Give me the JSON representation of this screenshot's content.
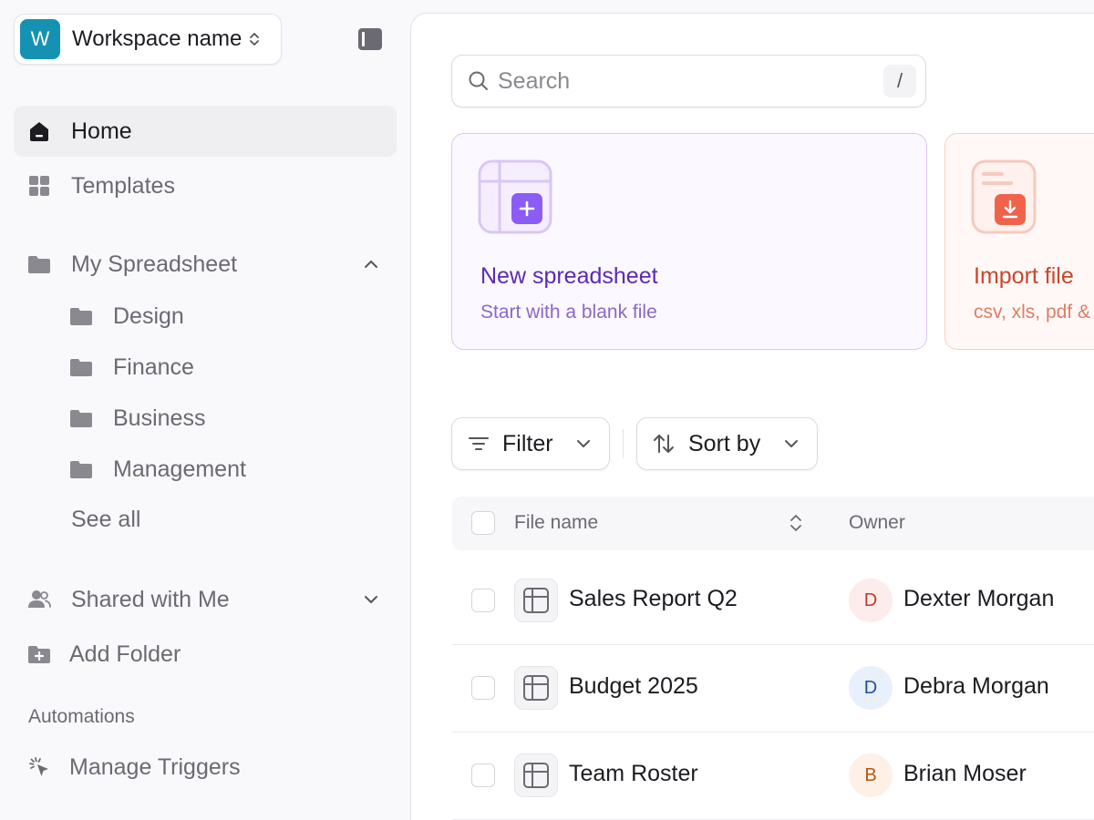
{
  "workspace": {
    "initial": "W",
    "name": "Workspace name",
    "avatar_color": "#1592b3"
  },
  "nav": {
    "home": "Home",
    "templates": "Templates",
    "my_spreadsheet": "My Spreadsheet",
    "folders": [
      "Design",
      "Finance",
      "Business",
      "Management"
    ],
    "see_all": "See all",
    "shared_with_me": "Shared with Me",
    "add_folder": "Add Folder",
    "automations_section": "Automations",
    "manage_triggers": "Manage Triggers"
  },
  "search": {
    "placeholder": "Search",
    "shortcut": "/"
  },
  "cards": {
    "new": {
      "title": "New spreadsheet",
      "subtitle": "Start with a blank file",
      "accent": "#8b5cf6"
    },
    "import": {
      "title": "Import file",
      "subtitle": "csv, xls, pdf &",
      "accent": "#f0634a"
    }
  },
  "toolbar": {
    "filter_label": "Filter",
    "sort_label": "Sort by"
  },
  "table": {
    "headers": {
      "file_name": "File name",
      "owner": "Owner"
    },
    "rows": [
      {
        "file": "Sales Report Q2",
        "owner_initial": "D",
        "owner": "Dexter Morgan",
        "avatar_bg": "#fdecec",
        "avatar_fg": "#c0392b"
      },
      {
        "file": "Budget 2025",
        "owner_initial": "D",
        "owner": "Debra Morgan",
        "avatar_bg": "#e8f0fc",
        "avatar_fg": "#1e4fa8"
      },
      {
        "file": "Team Roster",
        "owner_initial": "B",
        "owner": "Brian Moser",
        "avatar_bg": "#fdf0e6",
        "avatar_fg": "#b8560f"
      }
    ]
  }
}
